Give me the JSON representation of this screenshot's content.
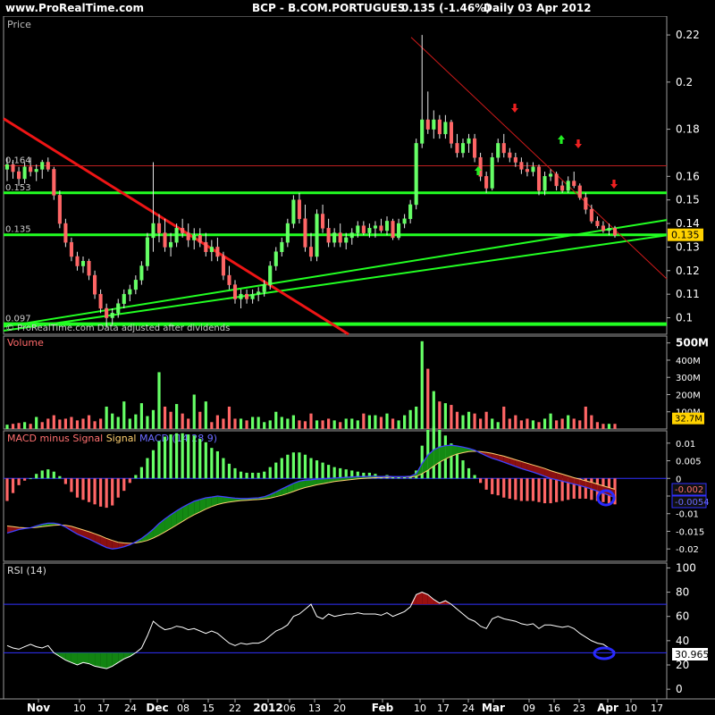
{
  "header": {
    "site": "www.ProRealTime.com",
    "symbol": "BCP - B.COM.PORTUGUES",
    "quote": "0.135 (-1.46%)",
    "period": "Daily 03 Apr 2012"
  },
  "colors": {
    "up": "#66ff66",
    "down": "#ff6666",
    "support": "#22ff22",
    "trend_down": "#ff2222",
    "macd_line": "#4040ff",
    "signal_line": "#ffd070",
    "hline_blue": "#3030ff"
  },
  "chart_data": [
    {
      "type": "candlestick",
      "title": "Price",
      "credit": "© ProRealTime.com Data adjusted after dividends",
      "y_ticks": [
        0.1,
        0.11,
        0.12,
        0.13,
        0.14,
        0.15,
        0.16,
        0.18,
        0.2,
        0.22
      ],
      "y_tick_labels": [
        "0.1",
        "0.11",
        "0.12",
        "0.13",
        "0.14",
        "0.15",
        "0.16",
        "0.18",
        "0.2",
        "0.22"
      ],
      "level_labels": [
        "0.164",
        "0.153",
        "0.135",
        "0.097"
      ],
      "last_price": "0.135",
      "x_labels": [
        "Nov",
        "10",
        "17",
        "24",
        "Dec",
        "08",
        "15",
        "22",
        "2012",
        "06",
        "13",
        "20",
        "Feb",
        "10",
        "17",
        "24",
        "Mar",
        "09",
        "16",
        "23",
        "Apr",
        "10",
        "17"
      ],
      "ohlc": [
        [
          0.163,
          0.168,
          0.158,
          0.165
        ],
        [
          0.165,
          0.167,
          0.159,
          0.162
        ],
        [
          0.162,
          0.164,
          0.156,
          0.159
        ],
        [
          0.159,
          0.166,
          0.157,
          0.164
        ],
        [
          0.164,
          0.168,
          0.16,
          0.162
        ],
        [
          0.162,
          0.165,
          0.158,
          0.163
        ],
        [
          0.163,
          0.167,
          0.159,
          0.166
        ],
        [
          0.166,
          0.168,
          0.162,
          0.163
        ],
        [
          0.163,
          0.164,
          0.15,
          0.152
        ],
        [
          0.152,
          0.154,
          0.138,
          0.14
        ],
        [
          0.14,
          0.142,
          0.13,
          0.132
        ],
        [
          0.132,
          0.134,
          0.124,
          0.126
        ],
        [
          0.126,
          0.128,
          0.12,
          0.122
        ],
        [
          0.122,
          0.126,
          0.119,
          0.124
        ],
        [
          0.124,
          0.125,
          0.116,
          0.118
        ],
        [
          0.118,
          0.12,
          0.108,
          0.11
        ],
        [
          0.11,
          0.112,
          0.102,
          0.104
        ],
        [
          0.104,
          0.106,
          0.096,
          0.1
        ],
        [
          0.1,
          0.104,
          0.097,
          0.102
        ],
        [
          0.102,
          0.108,
          0.1,
          0.106
        ],
        [
          0.106,
          0.112,
          0.104,
          0.11
        ],
        [
          0.11,
          0.114,
          0.107,
          0.112
        ],
        [
          0.112,
          0.118,
          0.11,
          0.116
        ],
        [
          0.116,
          0.124,
          0.114,
          0.122
        ],
        [
          0.122,
          0.136,
          0.12,
          0.134
        ],
        [
          0.134,
          0.166,
          0.128,
          0.14
        ],
        [
          0.14,
          0.144,
          0.132,
          0.136
        ],
        [
          0.136,
          0.142,
          0.128,
          0.13
        ],
        [
          0.13,
          0.136,
          0.126,
          0.132
        ],
        [
          0.132,
          0.14,
          0.13,
          0.138
        ],
        [
          0.138,
          0.142,
          0.134,
          0.136
        ],
        [
          0.136,
          0.14,
          0.13,
          0.133
        ],
        [
          0.133,
          0.138,
          0.129,
          0.135
        ],
        [
          0.135,
          0.138,
          0.13,
          0.132
        ],
        [
          0.132,
          0.136,
          0.126,
          0.128
        ],
        [
          0.128,
          0.133,
          0.124,
          0.13
        ],
        [
          0.13,
          0.134,
          0.124,
          0.126
        ],
        [
          0.126,
          0.128,
          0.116,
          0.118
        ],
        [
          0.118,
          0.122,
          0.112,
          0.114
        ],
        [
          0.114,
          0.116,
          0.106,
          0.108
        ],
        [
          0.108,
          0.112,
          0.104,
          0.11
        ],
        [
          0.11,
          0.112,
          0.106,
          0.108
        ],
        [
          0.108,
          0.112,
          0.106,
          0.11
        ],
        [
          0.11,
          0.113,
          0.107,
          0.111
        ],
        [
          0.111,
          0.116,
          0.109,
          0.114
        ],
        [
          0.114,
          0.124,
          0.112,
          0.122
        ],
        [
          0.122,
          0.13,
          0.12,
          0.128
        ],
        [
          0.128,
          0.134,
          0.126,
          0.132
        ],
        [
          0.132,
          0.142,
          0.13,
          0.14
        ],
        [
          0.14,
          0.152,
          0.138,
          0.15
        ],
        [
          0.15,
          0.153,
          0.14,
          0.142
        ],
        [
          0.142,
          0.148,
          0.128,
          0.13
        ],
        [
          0.13,
          0.136,
          0.124,
          0.126
        ],
        [
          0.126,
          0.146,
          0.124,
          0.144
        ],
        [
          0.144,
          0.148,
          0.136,
          0.138
        ],
        [
          0.138,
          0.142,
          0.13,
          0.132
        ],
        [
          0.132,
          0.138,
          0.13,
          0.136
        ],
        [
          0.136,
          0.14,
          0.13,
          0.132
        ],
        [
          0.132,
          0.136,
          0.129,
          0.134
        ],
        [
          0.134,
          0.138,
          0.131,
          0.136
        ],
        [
          0.136,
          0.141,
          0.134,
          0.139
        ],
        [
          0.139,
          0.141,
          0.135,
          0.136
        ],
        [
          0.136,
          0.14,
          0.134,
          0.138
        ],
        [
          0.138,
          0.141,
          0.134,
          0.139
        ],
        [
          0.139,
          0.142,
          0.136,
          0.137
        ],
        [
          0.137,
          0.143,
          0.135,
          0.141
        ],
        [
          0.141,
          0.142,
          0.133,
          0.134
        ],
        [
          0.134,
          0.142,
          0.133,
          0.14
        ],
        [
          0.14,
          0.144,
          0.138,
          0.142
        ],
        [
          0.142,
          0.15,
          0.14,
          0.148
        ],
        [
          0.148,
          0.176,
          0.146,
          0.174
        ],
        [
          0.174,
          0.22,
          0.172,
          0.184
        ],
        [
          0.184,
          0.196,
          0.178,
          0.18
        ],
        [
          0.18,
          0.188,
          0.176,
          0.184
        ],
        [
          0.184,
          0.186,
          0.176,
          0.178
        ],
        [
          0.178,
          0.186,
          0.176,
          0.183
        ],
        [
          0.183,
          0.184,
          0.172,
          0.174
        ],
        [
          0.174,
          0.178,
          0.168,
          0.17
        ],
        [
          0.17,
          0.176,
          0.168,
          0.174
        ],
        [
          0.174,
          0.178,
          0.17,
          0.176
        ],
        [
          0.176,
          0.178,
          0.166,
          0.168
        ],
        [
          0.168,
          0.17,
          0.158,
          0.16
        ],
        [
          0.16,
          0.162,
          0.153,
          0.155
        ],
        [
          0.155,
          0.17,
          0.154,
          0.168
        ],
        [
          0.168,
          0.176,
          0.166,
          0.174
        ],
        [
          0.174,
          0.178,
          0.168,
          0.17
        ],
        [
          0.17,
          0.172,
          0.166,
          0.168
        ],
        [
          0.168,
          0.17,
          0.164,
          0.166
        ],
        [
          0.166,
          0.168,
          0.161,
          0.163
        ],
        [
          0.163,
          0.166,
          0.16,
          0.162
        ],
        [
          0.162,
          0.166,
          0.16,
          0.164
        ],
        [
          0.164,
          0.165,
          0.152,
          0.154
        ],
        [
          0.154,
          0.162,
          0.152,
          0.16
        ],
        [
          0.16,
          0.163,
          0.158,
          0.161
        ],
        [
          0.161,
          0.162,
          0.154,
          0.156
        ],
        [
          0.156,
          0.158,
          0.153,
          0.154
        ],
        [
          0.154,
          0.16,
          0.153,
          0.158
        ],
        [
          0.158,
          0.162,
          0.155,
          0.156
        ],
        [
          0.156,
          0.157,
          0.15,
          0.151
        ],
        [
          0.151,
          0.153,
          0.144,
          0.146
        ],
        [
          0.146,
          0.148,
          0.14,
          0.141
        ],
        [
          0.141,
          0.143,
          0.138,
          0.139
        ],
        [
          0.139,
          0.141,
          0.136,
          0.137
        ],
        [
          0.137,
          0.14,
          0.135,
          0.138
        ],
        [
          0.138,
          0.139,
          0.134,
          0.135
        ]
      ]
    },
    {
      "type": "bar",
      "title": "Volume",
      "y_tick_labels": [
        "500M",
        "400M",
        "300M",
        "200M",
        "100M"
      ],
      "y_ticks": [
        500,
        400,
        300,
        200,
        100
      ],
      "last_value": "32.7M",
      "unit": "M",
      "values": [
        25,
        30,
        35,
        40,
        30,
        70,
        40,
        60,
        80,
        55,
        60,
        70,
        50,
        60,
        80,
        45,
        60,
        130,
        90,
        70,
        160,
        60,
        85,
        150,
        75,
        110,
        330,
        130,
        100,
        145,
        90,
        60,
        200,
        100,
        160,
        40,
        80,
        60,
        130,
        60,
        60,
        50,
        70,
        70,
        40,
        50,
        100,
        70,
        60,
        80,
        50,
        45,
        90,
        50,
        50,
        60,
        50,
        40,
        60,
        60,
        50,
        90,
        80,
        80,
        70,
        90,
        60,
        50,
        80,
        110,
        130,
        510,
        350,
        220,
        160,
        150,
        140,
        100,
        80,
        100,
        90,
        60,
        100,
        60,
        40,
        130,
        60,
        80,
        50,
        60,
        50,
        40,
        60,
        90,
        50,
        60,
        80,
        60,
        50,
        130,
        80,
        40,
        30,
        30,
        30
      ],
      "up": [
        1,
        0,
        0,
        1,
        0,
        1,
        0,
        0,
        0,
        0,
        0,
        0,
        0,
        0,
        0,
        0,
        0,
        1,
        1,
        1,
        1,
        1,
        1,
        1,
        1,
        1,
        1,
        0,
        0,
        1,
        0,
        0,
        1,
        0,
        1,
        0,
        0,
        0,
        0,
        0,
        1,
        0,
        1,
        1,
        1,
        1,
        1,
        1,
        1,
        1,
        0,
        0,
        0,
        1,
        0,
        0,
        1,
        0,
        1,
        1,
        1,
        0,
        1,
        1,
        0,
        1,
        0,
        1,
        1,
        1,
        1,
        1,
        0,
        1,
        0,
        1,
        0,
        0,
        1,
        1,
        0,
        0,
        0,
        1,
        1,
        0,
        0,
        0,
        0,
        0,
        1,
        0,
        1,
        1,
        0,
        0,
        1,
        0,
        0,
        0,
        0,
        0,
        0,
        1,
        0
      ]
    },
    {
      "type": "line",
      "title": "MACD minus Signal Signal MACD (14 28 9)",
      "title_parts": [
        "MACD minus Signal",
        "Signal",
        "MACD (14 28 9)"
      ],
      "y_ticks": [
        0.01,
        0.005,
        0,
        -0.005,
        -0.01,
        -0.015,
        -0.02
      ],
      "y_tick_labels": [
        "0.01",
        "0.005",
        "0",
        "-0.005",
        "-0.01",
        "-0.015",
        "-0.02"
      ],
      "last_labels": [
        "-0.002",
        "-0.0054"
      ],
      "macd": [
        -0.0155,
        -0.015,
        -0.0145,
        -0.0142,
        -0.014,
        -0.0135,
        -0.013,
        -0.0127,
        -0.0127,
        -0.013,
        -0.0138,
        -0.0148,
        -0.0158,
        -0.0165,
        -0.0172,
        -0.018,
        -0.0188,
        -0.0196,
        -0.02,
        -0.0198,
        -0.0194,
        -0.0188,
        -0.018,
        -0.017,
        -0.0158,
        -0.0144,
        -0.0128,
        -0.0115,
        -0.0103,
        -0.0092,
        -0.0082,
        -0.0073,
        -0.0065,
        -0.006,
        -0.0055,
        -0.0053,
        -0.005,
        -0.0052,
        -0.0054,
        -0.0056,
        -0.0057,
        -0.0057,
        -0.0056,
        -0.0055,
        -0.0052,
        -0.0046,
        -0.0038,
        -0.003,
        -0.0022,
        -0.0014,
        -0.0008,
        -0.0005,
        -0.0004,
        -0.0002,
        -0.0001,
        0.0,
        0.0001,
        0.0002,
        0.0003,
        0.0004,
        0.0005,
        0.0005,
        0.0006,
        0.0006,
        0.0005,
        0.0006,
        0.0005,
        0.0005,
        0.0005,
        0.0006,
        0.0013,
        0.0042,
        0.0066,
        0.0081,
        0.0089,
        0.0093,
        0.0094,
        0.0092,
        0.0089,
        0.0085,
        0.008,
        0.0072,
        0.0064,
        0.0057,
        0.0052,
        0.0046,
        0.004,
        0.0034,
        0.0028,
        0.0023,
        0.0018,
        0.0012,
        0.0006,
        0.0,
        -0.0004,
        -0.0008,
        -0.0012,
        -0.0016,
        -0.002,
        -0.0025,
        -0.003,
        -0.0036,
        -0.0042,
        -0.0048,
        -0.0054
      ],
      "signal": [
        -0.0135,
        -0.0137,
        -0.0139,
        -0.014,
        -0.014,
        -0.0139,
        -0.0137,
        -0.0135,
        -0.0133,
        -0.0132,
        -0.0133,
        -0.0136,
        -0.0141,
        -0.0146,
        -0.0151,
        -0.0157,
        -0.0163,
        -0.017,
        -0.0176,
        -0.0181,
        -0.0183,
        -0.0184,
        -0.0183,
        -0.018,
        -0.0176,
        -0.0169,
        -0.0161,
        -0.0152,
        -0.0142,
        -0.0132,
        -0.0122,
        -0.0112,
        -0.0103,
        -0.0095,
        -0.0087,
        -0.008,
        -0.0074,
        -0.007,
        -0.0067,
        -0.0065,
        -0.0063,
        -0.0062,
        -0.0061,
        -0.006,
        -0.0058,
        -0.0056,
        -0.0052,
        -0.0048,
        -0.0043,
        -0.0037,
        -0.0031,
        -0.0026,
        -0.0022,
        -0.0018,
        -0.0015,
        -0.0012,
        -0.0009,
        -0.0007,
        -0.0005,
        -0.0003,
        -0.0001,
        0.0,
        0.0001,
        0.0002,
        0.0003,
        0.0003,
        0.0004,
        0.0004,
        0.0004,
        0.0004,
        0.0006,
        0.0013,
        0.0023,
        0.0035,
        0.0046,
        0.0055,
        0.0063,
        0.0069,
        0.0073,
        0.0076,
        0.0077,
        0.0076,
        0.0074,
        0.0071,
        0.0067,
        0.0063,
        0.0058,
        0.0053,
        0.0048,
        0.0043,
        0.0038,
        0.0033,
        0.0028,
        0.0022,
        0.0017,
        0.0012,
        0.0007,
        0.0002,
        -0.0002,
        -0.0007,
        -0.0011,
        -0.0016,
        -0.0021,
        -0.0026,
        -0.0031
      ]
    },
    {
      "type": "line",
      "title": "RSI (14)",
      "y_ticks": [
        100,
        80,
        60,
        40,
        20,
        0
      ],
      "y_tick_labels": [
        "100",
        "80",
        "60",
        "40",
        "20",
        "0"
      ],
      "levels": [
        70,
        30
      ],
      "last_value": "30.965",
      "values": [
        36,
        34,
        33,
        35,
        37,
        35,
        34,
        36,
        30,
        27,
        24,
        22,
        20,
        22,
        21,
        19,
        18,
        17,
        19,
        22,
        25,
        27,
        30,
        34,
        44,
        56,
        52,
        49,
        50,
        52,
        51,
        49,
        50,
        48,
        46,
        48,
        46,
        42,
        38,
        36,
        38,
        37,
        38,
        38,
        40,
        44,
        48,
        50,
        53,
        60,
        62,
        66,
        70,
        60,
        58,
        62,
        60,
        61,
        62,
        62,
        63,
        62,
        62,
        62,
        61,
        63,
        60,
        62,
        64,
        68,
        78,
        80,
        78,
        74,
        71,
        73,
        70,
        66,
        62,
        58,
        56,
        52,
        50,
        58,
        60,
        58,
        57,
        56,
        54,
        53,
        54,
        50,
        53,
        53,
        52,
        51,
        52,
        50,
        46,
        43,
        40,
        38,
        37,
        34,
        31
      ]
    }
  ]
}
